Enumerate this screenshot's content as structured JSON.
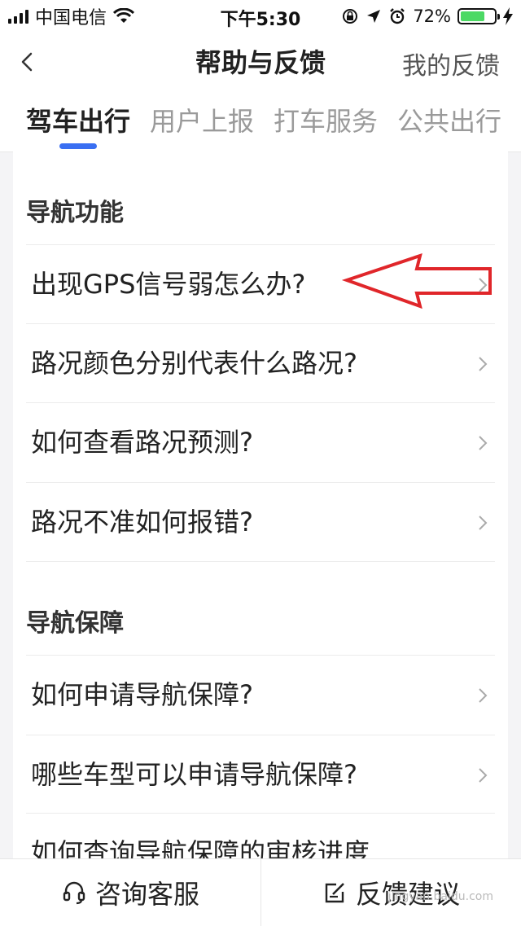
{
  "status_bar": {
    "carrier": "中国电信",
    "time": "下午5:30",
    "battery": "72%",
    "battery_level": 0.72,
    "icons": [
      "signal-icon",
      "wifi-icon",
      "orientation-lock-icon",
      "location-icon",
      "alarm-icon",
      "battery-icon",
      "charging-icon"
    ]
  },
  "nav": {
    "title": "帮助与反馈",
    "right_link": "我的反馈",
    "back_icon": "chevron-left-icon"
  },
  "tabs": [
    {
      "label": "驾车出行",
      "active": true
    },
    {
      "label": "用户上报",
      "active": false
    },
    {
      "label": "打车服务",
      "active": false
    },
    {
      "label": "公共出行",
      "active": false
    }
  ],
  "colors": {
    "accent": "#3a6ff2",
    "annotation": "#e0262a",
    "battery": "#4cd964"
  },
  "sections": [
    {
      "title": "导航功能",
      "items": [
        "出现GPS信号弱怎么办?",
        "路况颜色分别代表什么路况?",
        "如何查看路况预测?",
        "路况不准如何报错?"
      ]
    },
    {
      "title": "导航保障",
      "items": [
        "如何申请导航保障?",
        "哪些车型可以申请导航保障?",
        "如何查询导航保障的审核进度"
      ]
    }
  ],
  "bottom_bar": {
    "consult": "咨询客服",
    "feedback": "反馈建议",
    "consult_icon": "headset-icon",
    "feedback_icon": "edit-icon"
  },
  "watermark": "jingyan.baidu.com"
}
